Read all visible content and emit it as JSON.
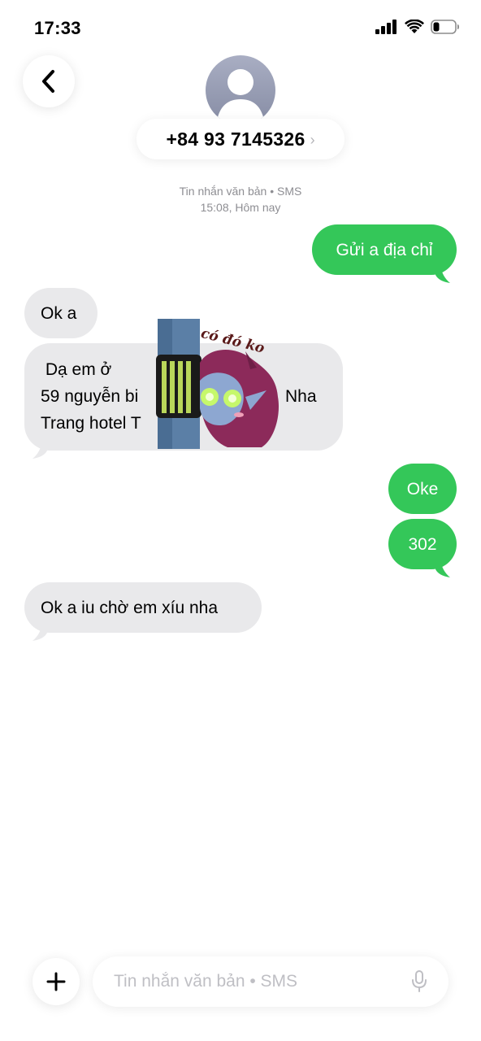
{
  "status_bar": {
    "time": "17:33",
    "icons": [
      "cellular-signal-icon",
      "wifi-icon",
      "battery-icon"
    ]
  },
  "header": {
    "back_icon": "chevron-left-icon",
    "avatar_icon": "person-silhouette-icon",
    "contact_number": "+84 93 7145326",
    "contact_chevron": "›"
  },
  "conversation": {
    "service_label": "Tin nhắn văn bản • SMS",
    "timestamp": "15:08, Hôm nay"
  },
  "messages": [
    {
      "direction": "outgoing",
      "text": "Gửi a địa chỉ"
    },
    {
      "direction": "incoming",
      "text": "Ok a"
    },
    {
      "direction": "incoming",
      "lines": [
        " Dạ em ở",
        "59 nguyễn bi",
        "Trang hotel T"
      ],
      "trailing_text": "Nha"
    },
    {
      "direction": "outgoing",
      "text": "Oke"
    },
    {
      "direction": "outgoing",
      "text": "302"
    },
    {
      "direction": "incoming",
      "text": "Ok a iu chờ em xíu nha"
    }
  ],
  "sticker": {
    "caption": "có đó ko",
    "description_icon": "peeking-character-sticker"
  },
  "input_bar": {
    "add_icon": "plus-icon",
    "placeholder": "Tin nhắn văn bản • SMS",
    "mic_icon": "microphone-icon"
  },
  "colors": {
    "outgoing_bubble": "#34c759",
    "incoming_bubble": "#e9e9eb",
    "meta_text": "#8e8e93",
    "placeholder_text": "#bfbfc4"
  }
}
